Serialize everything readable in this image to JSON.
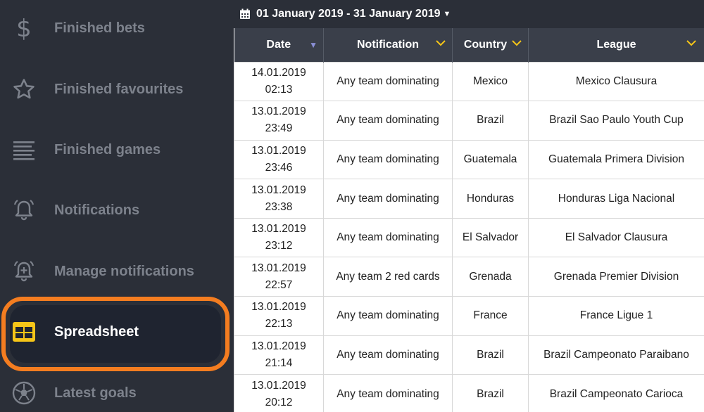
{
  "sidebar": {
    "items": [
      {
        "label": "Finished bets",
        "icon": "dollar-icon"
      },
      {
        "label": "Finished favourites",
        "icon": "star-icon"
      },
      {
        "label": "Finished games",
        "icon": "lines-icon"
      },
      {
        "label": "Notifications",
        "icon": "bell-icon"
      },
      {
        "label": "Manage notifications",
        "icon": "bell-plus-icon"
      },
      {
        "label": "Spreadsheet",
        "icon": "spreadsheet-icon",
        "active": true
      },
      {
        "label": "Latest goals",
        "icon": "football-icon"
      }
    ]
  },
  "header": {
    "date_range": "01 January 2019 - 31 January 2019"
  },
  "table": {
    "columns": [
      "Date",
      "Notification",
      "Country",
      "League"
    ],
    "rows": [
      {
        "date": "14.01.2019",
        "time": "02:13",
        "notification": "Any team dominating",
        "country": "Mexico",
        "league": "Mexico Clausura"
      },
      {
        "date": "13.01.2019",
        "time": "23:49",
        "notification": "Any team dominating",
        "country": "Brazil",
        "league": "Brazil Sao Paulo Youth Cup"
      },
      {
        "date": "13.01.2019",
        "time": "23:46",
        "notification": "Any team dominating",
        "country": "Guatemala",
        "league": "Guatemala Primera Division"
      },
      {
        "date": "13.01.2019",
        "time": "23:38",
        "notification": "Any team dominating",
        "country": "Honduras",
        "league": "Honduras Liga Nacional"
      },
      {
        "date": "13.01.2019",
        "time": "23:12",
        "notification": "Any team dominating",
        "country": "El Salvador",
        "league": "El Salvador Clausura"
      },
      {
        "date": "13.01.2019",
        "time": "22:57",
        "notification": "Any team 2 red cards",
        "country": "Grenada",
        "league": "Grenada Premier Division"
      },
      {
        "date": "13.01.2019",
        "time": "22:13",
        "notification": "Any team dominating",
        "country": "France",
        "league": "France Ligue 1"
      },
      {
        "date": "13.01.2019",
        "time": "21:14",
        "notification": "Any team dominating",
        "country": "Brazil",
        "league": "Brazil Campeonato Paraibano"
      },
      {
        "date": "13.01.2019",
        "time": "20:12",
        "notification": "Any team dominating",
        "country": "Brazil",
        "league": "Brazil Campeonato Carioca"
      }
    ]
  },
  "colors": {
    "sidebar_bg": "#2b2f38",
    "accent_orange": "#f47d20",
    "icon_yellow": "#f5c518",
    "header_bg": "#3a3f4a"
  }
}
